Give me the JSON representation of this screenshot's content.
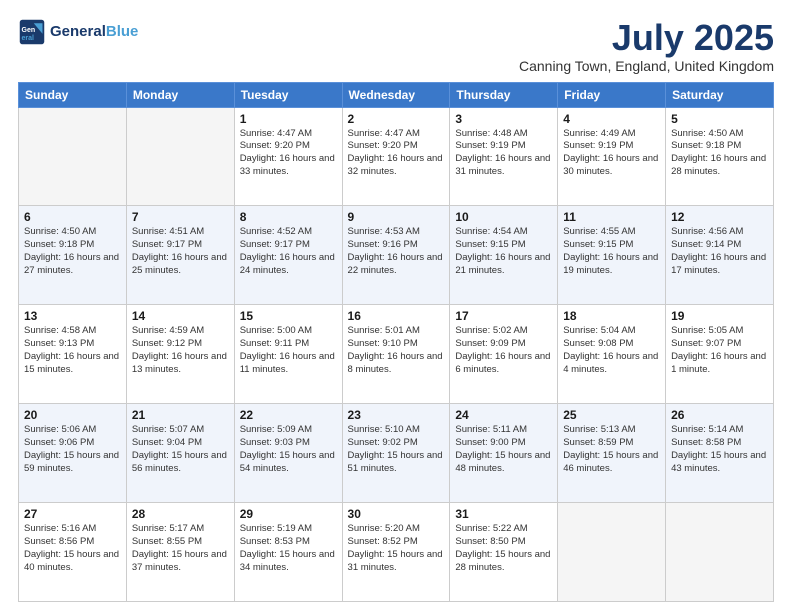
{
  "header": {
    "logo_line1": "General",
    "logo_line2": "Blue",
    "month_title": "July 2025",
    "location": "Canning Town, England, United Kingdom"
  },
  "days_of_week": [
    "Sunday",
    "Monday",
    "Tuesday",
    "Wednesday",
    "Thursday",
    "Friday",
    "Saturday"
  ],
  "weeks": [
    [
      {
        "day": "",
        "info": ""
      },
      {
        "day": "",
        "info": ""
      },
      {
        "day": "1",
        "info": "Sunrise: 4:47 AM\nSunset: 9:20 PM\nDaylight: 16 hours and 33 minutes."
      },
      {
        "day": "2",
        "info": "Sunrise: 4:47 AM\nSunset: 9:20 PM\nDaylight: 16 hours and 32 minutes."
      },
      {
        "day": "3",
        "info": "Sunrise: 4:48 AM\nSunset: 9:19 PM\nDaylight: 16 hours and 31 minutes."
      },
      {
        "day": "4",
        "info": "Sunrise: 4:49 AM\nSunset: 9:19 PM\nDaylight: 16 hours and 30 minutes."
      },
      {
        "day": "5",
        "info": "Sunrise: 4:50 AM\nSunset: 9:18 PM\nDaylight: 16 hours and 28 minutes."
      }
    ],
    [
      {
        "day": "6",
        "info": "Sunrise: 4:50 AM\nSunset: 9:18 PM\nDaylight: 16 hours and 27 minutes."
      },
      {
        "day": "7",
        "info": "Sunrise: 4:51 AM\nSunset: 9:17 PM\nDaylight: 16 hours and 25 minutes."
      },
      {
        "day": "8",
        "info": "Sunrise: 4:52 AM\nSunset: 9:17 PM\nDaylight: 16 hours and 24 minutes."
      },
      {
        "day": "9",
        "info": "Sunrise: 4:53 AM\nSunset: 9:16 PM\nDaylight: 16 hours and 22 minutes."
      },
      {
        "day": "10",
        "info": "Sunrise: 4:54 AM\nSunset: 9:15 PM\nDaylight: 16 hours and 21 minutes."
      },
      {
        "day": "11",
        "info": "Sunrise: 4:55 AM\nSunset: 9:15 PM\nDaylight: 16 hours and 19 minutes."
      },
      {
        "day": "12",
        "info": "Sunrise: 4:56 AM\nSunset: 9:14 PM\nDaylight: 16 hours and 17 minutes."
      }
    ],
    [
      {
        "day": "13",
        "info": "Sunrise: 4:58 AM\nSunset: 9:13 PM\nDaylight: 16 hours and 15 minutes."
      },
      {
        "day": "14",
        "info": "Sunrise: 4:59 AM\nSunset: 9:12 PM\nDaylight: 16 hours and 13 minutes."
      },
      {
        "day": "15",
        "info": "Sunrise: 5:00 AM\nSunset: 9:11 PM\nDaylight: 16 hours and 11 minutes."
      },
      {
        "day": "16",
        "info": "Sunrise: 5:01 AM\nSunset: 9:10 PM\nDaylight: 16 hours and 8 minutes."
      },
      {
        "day": "17",
        "info": "Sunrise: 5:02 AM\nSunset: 9:09 PM\nDaylight: 16 hours and 6 minutes."
      },
      {
        "day": "18",
        "info": "Sunrise: 5:04 AM\nSunset: 9:08 PM\nDaylight: 16 hours and 4 minutes."
      },
      {
        "day": "19",
        "info": "Sunrise: 5:05 AM\nSunset: 9:07 PM\nDaylight: 16 hours and 1 minute."
      }
    ],
    [
      {
        "day": "20",
        "info": "Sunrise: 5:06 AM\nSunset: 9:06 PM\nDaylight: 15 hours and 59 minutes."
      },
      {
        "day": "21",
        "info": "Sunrise: 5:07 AM\nSunset: 9:04 PM\nDaylight: 15 hours and 56 minutes."
      },
      {
        "day": "22",
        "info": "Sunrise: 5:09 AM\nSunset: 9:03 PM\nDaylight: 15 hours and 54 minutes."
      },
      {
        "day": "23",
        "info": "Sunrise: 5:10 AM\nSunset: 9:02 PM\nDaylight: 15 hours and 51 minutes."
      },
      {
        "day": "24",
        "info": "Sunrise: 5:11 AM\nSunset: 9:00 PM\nDaylight: 15 hours and 48 minutes."
      },
      {
        "day": "25",
        "info": "Sunrise: 5:13 AM\nSunset: 8:59 PM\nDaylight: 15 hours and 46 minutes."
      },
      {
        "day": "26",
        "info": "Sunrise: 5:14 AM\nSunset: 8:58 PM\nDaylight: 15 hours and 43 minutes."
      }
    ],
    [
      {
        "day": "27",
        "info": "Sunrise: 5:16 AM\nSunset: 8:56 PM\nDaylight: 15 hours and 40 minutes."
      },
      {
        "day": "28",
        "info": "Sunrise: 5:17 AM\nSunset: 8:55 PM\nDaylight: 15 hours and 37 minutes."
      },
      {
        "day": "29",
        "info": "Sunrise: 5:19 AM\nSunset: 8:53 PM\nDaylight: 15 hours and 34 minutes."
      },
      {
        "day": "30",
        "info": "Sunrise: 5:20 AM\nSunset: 8:52 PM\nDaylight: 15 hours and 31 minutes."
      },
      {
        "day": "31",
        "info": "Sunrise: 5:22 AM\nSunset: 8:50 PM\nDaylight: 15 hours and 28 minutes."
      },
      {
        "day": "",
        "info": ""
      },
      {
        "day": "",
        "info": ""
      }
    ]
  ]
}
